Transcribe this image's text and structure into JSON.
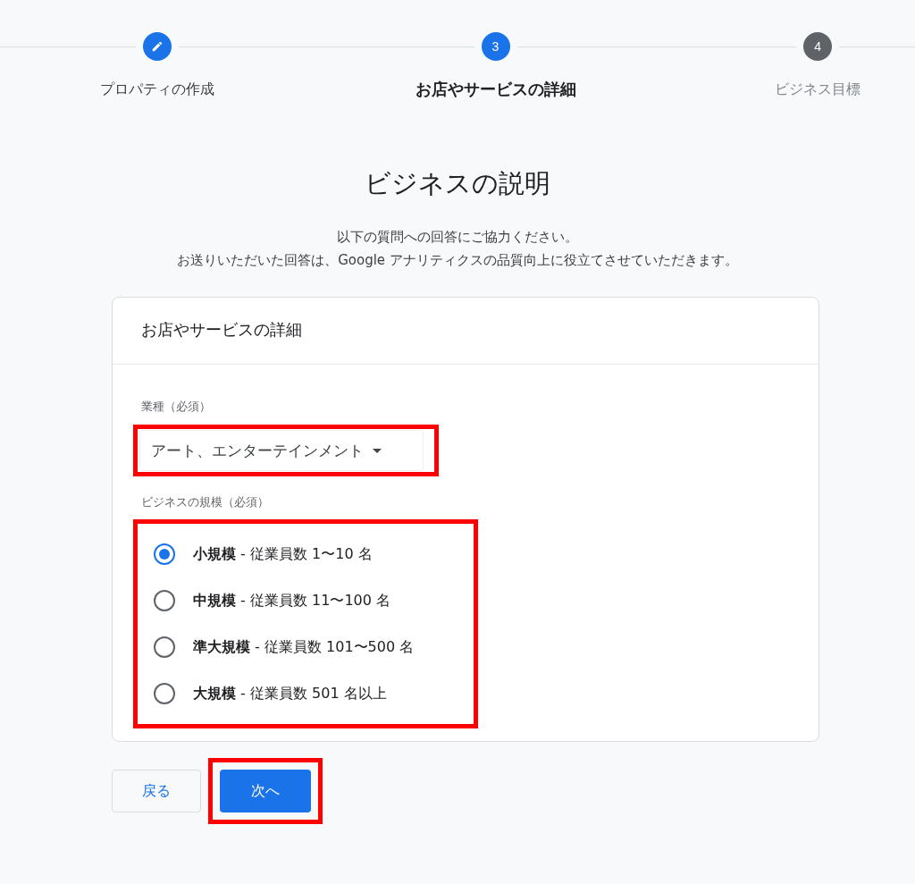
{
  "stepper": [
    {
      "kind": "done",
      "label": "プロパティの作成"
    },
    {
      "kind": "current",
      "number": "3",
      "label": "お店やサービスの詳細"
    },
    {
      "kind": "upcoming",
      "number": "4",
      "label": "ビジネス目標"
    }
  ],
  "title": "ビジネスの説明",
  "subtitle": [
    "以下の質問への回答にご協力ください。",
    "お送りいただいた回答は、Google アナリティクスの品質向上に役立てさせていただきます。"
  ],
  "card": {
    "header": "お店やサービスの詳細",
    "industry": {
      "label": "業種（必須）",
      "value": "アート、エンターテインメント",
      "highlighted": true
    },
    "size": {
      "label": "ビジネスの規模（必須）",
      "highlighted": true,
      "options": [
        {
          "label": "**小規模** - 従業員数 1〜10 名",
          "selected": true
        },
        {
          "label": "**中規模** - 従業員数 11〜100 名",
          "selected": false
        },
        {
          "label": "**準大規模** - 従業員数 101〜500 名",
          "selected": false
        },
        {
          "label": "**大規模** - 従業員数 501 名以上",
          "selected": false
        }
      ]
    }
  },
  "buttons": {
    "back": {
      "label": "戻る"
    },
    "next": {
      "label": "次へ",
      "highlighted": true
    }
  }
}
